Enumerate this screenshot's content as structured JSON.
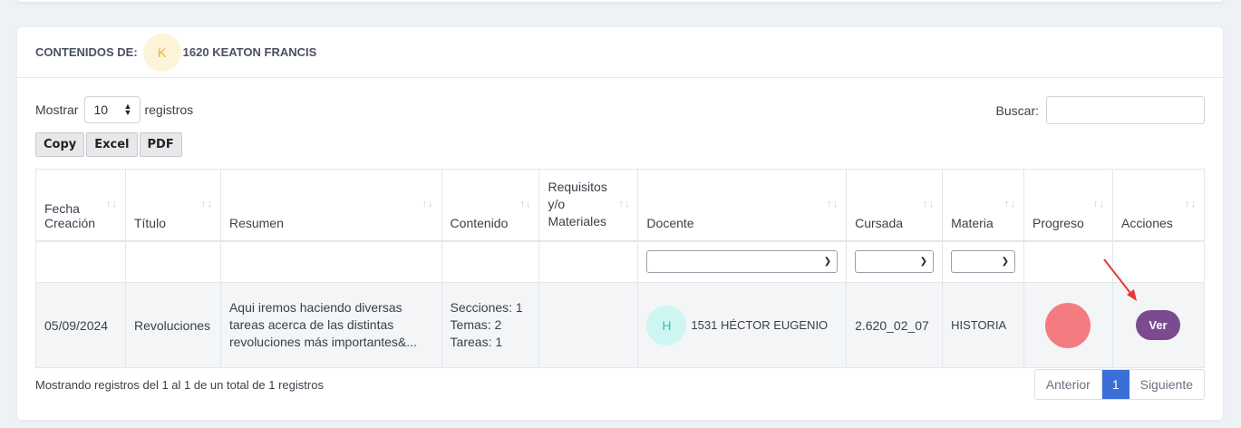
{
  "header": {
    "label": "CONTENIDOS DE:",
    "avatar_letter": "K",
    "student": "1620 KEATON FRANCIS"
  },
  "length": {
    "prefix": "Mostrar",
    "value": "10",
    "suffix": "registros"
  },
  "search": {
    "label": "Buscar:",
    "value": ""
  },
  "buttons": {
    "copy": "Copy",
    "excel": "Excel",
    "pdf": "PDF"
  },
  "columns": [
    "Fecha Creación",
    "Título",
    "Resumen",
    "Contenido",
    "Requisitos y/o Materiales",
    "Docente",
    "Cursada",
    "Materia",
    "Progreso",
    "Acciones"
  ],
  "row": {
    "fecha": "05/09/2024",
    "titulo": "Revoluciones",
    "resumen": "Aqui iremos haciendo diversas tareas acerca de las distintas revoluciones más importantes&...",
    "contenido": [
      "Secciones: 1",
      "Temas: 2",
      "Tareas: 1"
    ],
    "requisitos": "",
    "docente_initial": "H",
    "docente": "1531 HÉCTOR EUGENIO",
    "cursada": "2.620_02_07",
    "materia": "HISTORIA",
    "progress_color": "#f47c80",
    "action": "Ver"
  },
  "footer": {
    "info": "Mostrando registros del 1 al 1 de un total de 1 registros"
  },
  "pagination": {
    "prev": "Anterior",
    "current": "1",
    "next": "Siguiente"
  },
  "colors": {
    "accent": "#3b6fd8",
    "action": "#7b4a8f",
    "arrow": "#e53935"
  }
}
